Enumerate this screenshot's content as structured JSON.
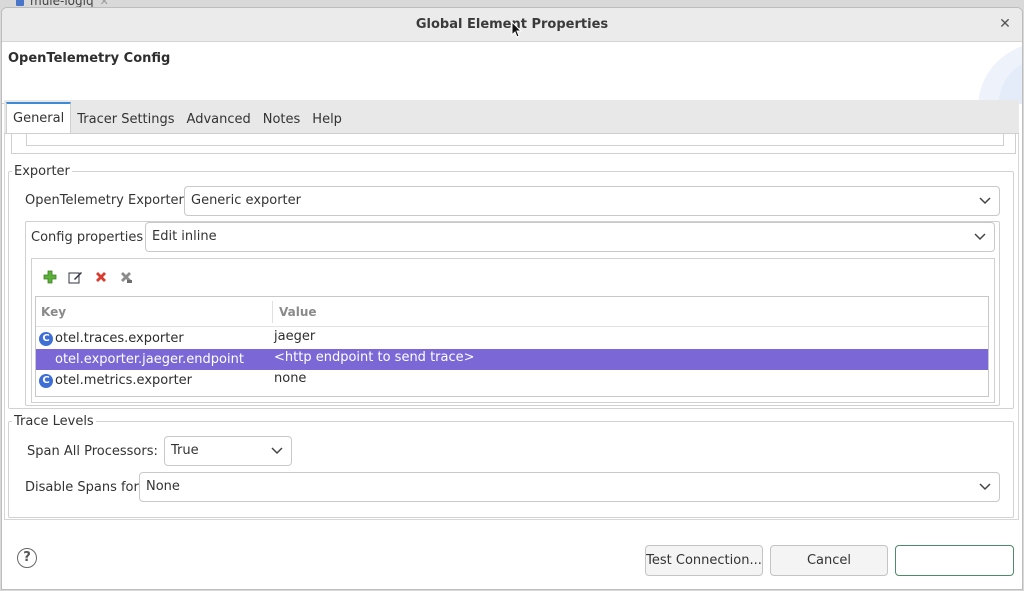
{
  "background_tab": {
    "label": "mule-logiq"
  },
  "dialog": {
    "title": "Global Element Properties",
    "header_title": "OpenTelemetry Config"
  },
  "tabs": [
    {
      "label": "General",
      "active": true
    },
    {
      "label": "Tracer Settings"
    },
    {
      "label": "Advanced"
    },
    {
      "label": "Notes"
    },
    {
      "label": "Help"
    }
  ],
  "exporter": {
    "legend": "Exporter",
    "exporter_label": "OpenTelemetry Exporter",
    "exporter_value": "Generic exporter",
    "config_label": "Config properties",
    "config_value": "Edit inline",
    "toolbar_icons": [
      "add-icon",
      "edit-icon",
      "delete-icon",
      "clear-all-icon"
    ],
    "table": {
      "headers": {
        "key": "Key",
        "value": "Value"
      },
      "rows": [
        {
          "key": "otel.traces.exporter",
          "value": "jaeger",
          "selected": false,
          "badge": "C"
        },
        {
          "key": "otel.exporter.jaeger.endpoint",
          "value": "<http endpoint to send trace>",
          "selected": true,
          "badge": ""
        },
        {
          "key": "otel.metrics.exporter",
          "value": "none",
          "selected": false,
          "badge": "C"
        }
      ]
    }
  },
  "trace_levels": {
    "legend": "Trace Levels",
    "span_label": "Span All Processors:",
    "span_value": "True",
    "disable_label": "Disable Spans for",
    "disable_value": "None"
  },
  "footer": {
    "help_icon": "?",
    "test_connection": "Test Connection...",
    "cancel": "Cancel",
    "ok": ""
  },
  "colors": {
    "selection": "#7b68d6",
    "tab_accent": "#3c8ad8",
    "badge": "#3e6fd6"
  }
}
